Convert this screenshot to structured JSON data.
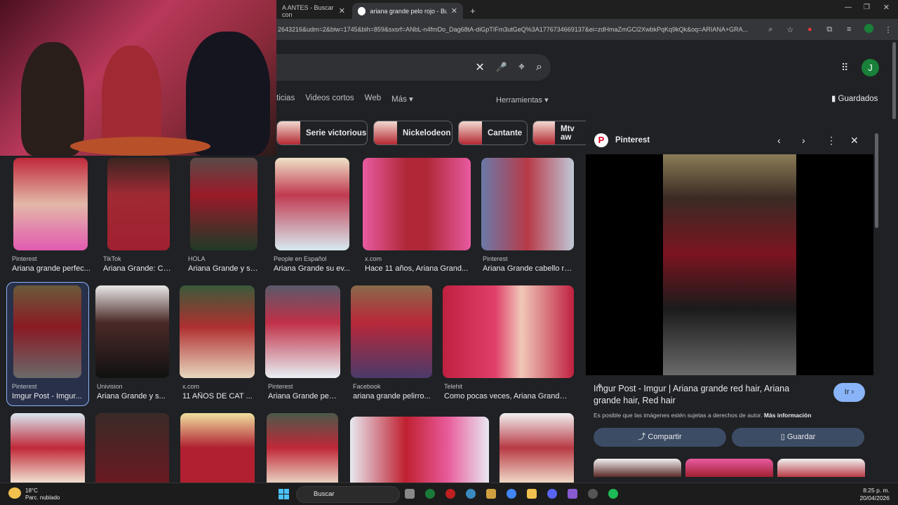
{
  "tabs": [
    {
      "title": "A ANTES - Buscar con",
      "close": "✕"
    },
    {
      "title": "ariana grande pelo rojo - Buscar",
      "close": "✕"
    }
  ],
  "new_tab": "+",
  "url": "2643216&udm=2&biw=1745&bih=859&sxsrf=ANbL-n4fmDo_Dag68tA-diGpTIFm3utGeQ%3A1776734669137&ei=zdHmaZmGCl2XwbkPqKq9kQk&oq=ARIANA+GRA...",
  "search_tools": {
    "clear": "✕",
    "voice": "🎤",
    "lens": "⌖",
    "search": "⌕"
  },
  "avatar": "J",
  "filters": [
    "ticias",
    "Videos cortos",
    "Web",
    "Más ▾"
  ],
  "herramientas": "Herramientas ▾",
  "guardados": "Guardados",
  "chips": [
    "Serie victorious",
    "Nickelodeon",
    "Cantante",
    "Mtv aw"
  ],
  "results": [
    {
      "source": "Pinterest",
      "title": "Ariana grande perfec..."
    },
    {
      "source": "TikTok",
      "title": "Ariana Grande: Ca..."
    },
    {
      "source": "HOLA",
      "title": "Ariana Grande y su..."
    },
    {
      "source": "People en Español",
      "title": "Ariana Grande su ev..."
    },
    {
      "source": "x.com",
      "title": "Hace 11 años, Ariana Grand..."
    },
    {
      "source": "Pinterest",
      "title": "Ariana Grande cabello rojo"
    },
    {
      "source": "Pinterest",
      "title": "Imgur Post - Imgur..."
    },
    {
      "source": "Univision",
      "title": "Ariana Grande y s..."
    },
    {
      "source": "x.com",
      "title": "11 AÑOS DE CAT ..."
    },
    {
      "source": "Pinterest",
      "title": "Ariana Grande peli..."
    },
    {
      "source": "Facebook",
      "title": "ariana grande pelirro..."
    },
    {
      "source": "Telehit",
      "title": "Como pocas veces, Ariana Grande ..."
    }
  ],
  "panel": {
    "source": "Pinterest",
    "title": "Imgur Post - Imgur | Ariana grande red hair, Ariana grande hair, Red hair",
    "go": "Ir ›",
    "copyright": "Es posible que las imágenes estén sujetas a derechos de autor.",
    "more_info": "Más información",
    "share": "Compartir",
    "save": "Guardar"
  },
  "taskbar": {
    "temp": "18°C",
    "weather": "Parc. nublado",
    "search": "Buscar",
    "time": "8:25 p. m.",
    "date": "20/04/2026"
  }
}
